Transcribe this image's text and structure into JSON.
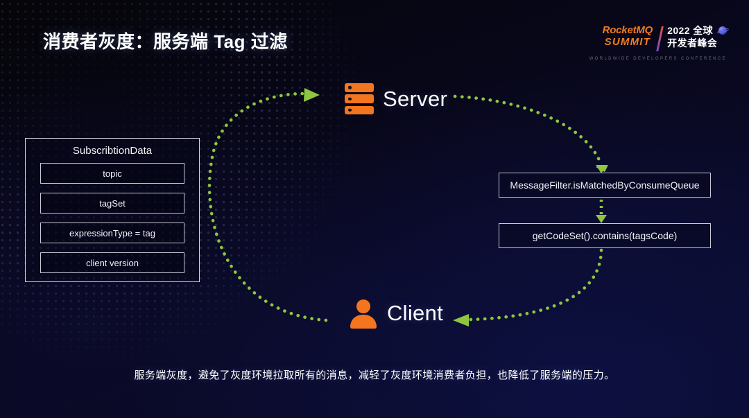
{
  "header": {
    "title": "消费者灰度：服务端 Tag 过滤"
  },
  "logo": {
    "brand_line1": "RocketMQ",
    "brand_line2": "SUMMIT",
    "year_line": "2022 全球",
    "event_line": "开发者峰会",
    "tagline": "WORLDWIDE DEVELOPERS CONFERENCE",
    "brand_color": "#f07b1d",
    "planet_icon": "planet-icon"
  },
  "panel": {
    "title": "SubscribtionData",
    "rows": [
      {
        "label": "topic"
      },
      {
        "label": "tagSet"
      },
      {
        "label": "expressionType = tag"
      },
      {
        "label": "client version"
      }
    ],
    "border_color": "#d2d2dc"
  },
  "nodes": {
    "server": {
      "label": "Server",
      "icon": "server-icon",
      "icon_color": "#f4751f"
    },
    "client": {
      "label": "Client",
      "icon": "user-icon",
      "icon_color": "#f4751f"
    }
  },
  "boxes": [
    {
      "label": "MessageFilter.isMatchedByConsumeQueue"
    },
    {
      "label": "getCodeSet().contains(tagsCode)"
    }
  ],
  "flow": {
    "arrow_color": "#8fc63f",
    "style": "dotted",
    "edges": [
      {
        "from": "client",
        "to": "server",
        "direction": "up-right"
      },
      {
        "from": "server",
        "to": "MessageFilter.isMatchedByConsumeQueue",
        "direction": "down-right"
      },
      {
        "from": "MessageFilter.isMatchedByConsumeQueue",
        "to": "getCodeSet().contains(tagsCode)",
        "direction": "down"
      },
      {
        "from": "getCodeSet().contains(tagsCode)",
        "to": "client",
        "direction": "down-left"
      }
    ]
  },
  "footer": {
    "caption": "服务端灰度，避免了灰度环境拉取所有的消息，减轻了灰度环境消费者负担，也降低了服务端的压力。"
  },
  "theme": {
    "background_top": "#050509",
    "background_bottom": "#0b0b2c",
    "accent_orange": "#f4751f",
    "accent_green": "#8fc63f",
    "text_primary": "#ffffff"
  }
}
